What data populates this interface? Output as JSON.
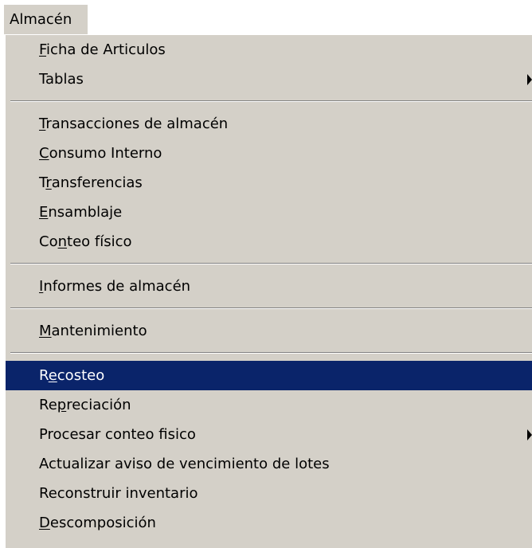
{
  "menubar": {
    "title": "Almacén"
  },
  "menu": {
    "items": [
      {
        "label_pre": "",
        "mnemonic": "F",
        "label_post": "icha de Articulos",
        "submenu": false,
        "selected": false
      },
      {
        "label_pre": "Tablas",
        "mnemonic": "",
        "label_post": "",
        "submenu": true,
        "selected": false
      },
      {
        "separator": true
      },
      {
        "label_pre": "",
        "mnemonic": "T",
        "label_post": "ransacciones de almacén",
        "submenu": false,
        "selected": false
      },
      {
        "label_pre": "",
        "mnemonic": "C",
        "label_post": "onsumo Interno",
        "submenu": false,
        "selected": false
      },
      {
        "label_pre": "T",
        "mnemonic": "r",
        "label_post": "ansferencias",
        "submenu": false,
        "selected": false
      },
      {
        "label_pre": "",
        "mnemonic": "E",
        "label_post": "nsamblaje",
        "submenu": false,
        "selected": false
      },
      {
        "label_pre": "Co",
        "mnemonic": "n",
        "label_post": "teo físico",
        "submenu": false,
        "selected": false
      },
      {
        "separator": true
      },
      {
        "label_pre": "",
        "mnemonic": "I",
        "label_post": "nformes de almacén",
        "submenu": false,
        "selected": false
      },
      {
        "separator": true
      },
      {
        "label_pre": "",
        "mnemonic": "M",
        "label_post": "antenimiento",
        "submenu": false,
        "selected": false
      },
      {
        "separator": true
      },
      {
        "label_pre": "R",
        "mnemonic": "e",
        "label_post": "costeo",
        "submenu": false,
        "selected": true
      },
      {
        "label_pre": "Re",
        "mnemonic": "p",
        "label_post": "reciación",
        "submenu": false,
        "selected": false
      },
      {
        "label_pre": "Procesar conteo fisico",
        "mnemonic": "",
        "label_post": "",
        "submenu": true,
        "selected": false
      },
      {
        "label_pre": "Actualizar aviso de vencimiento de lotes",
        "mnemonic": "",
        "label_post": "",
        "submenu": false,
        "selected": false
      },
      {
        "label_pre": "Reconstruir inventario",
        "mnemonic": "",
        "label_post": "",
        "submenu": false,
        "selected": false
      },
      {
        "label_pre": "",
        "mnemonic": "D",
        "label_post": "escomposición",
        "submenu": false,
        "selected": false
      }
    ]
  },
  "colors": {
    "menu_bg": "#d4d0c8",
    "selection_bg": "#0a246a",
    "selection_text": "#ffffff"
  }
}
